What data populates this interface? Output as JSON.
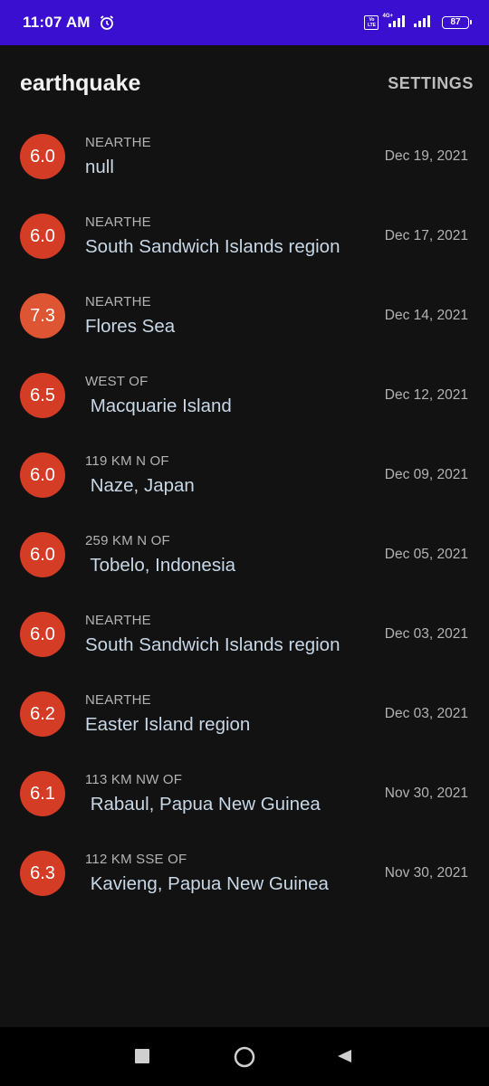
{
  "status_bar": {
    "time": "11:07 AM",
    "volte": "Vo LTE",
    "network": "4G+",
    "battery": "87"
  },
  "app_bar": {
    "title": "earthquake",
    "settings_label": "SETTINGS"
  },
  "colors": {
    "status_bar_bg": "#3a0fd0",
    "background": "#121212",
    "magnitude_circle": "#d43c25"
  },
  "quakes": [
    {
      "magnitude": "6.0",
      "offset": "NEARTHE",
      "location": "null",
      "date": "Dec 19, 2021"
    },
    {
      "magnitude": "6.0",
      "offset": "NEARTHE",
      "location": "South Sandwich Islands region",
      "date": "Dec 17, 2021"
    },
    {
      "magnitude": "7.3",
      "offset": "NEARTHE",
      "location": "Flores Sea",
      "date": "Dec 14, 2021"
    },
    {
      "magnitude": "6.5",
      "offset": "WEST OF",
      "location": " Macquarie Island",
      "date": "Dec 12, 2021"
    },
    {
      "magnitude": "6.0",
      "offset": "119 KM N OF",
      "location": " Naze, Japan",
      "date": "Dec 09, 2021"
    },
    {
      "magnitude": "6.0",
      "offset": "259 KM N OF",
      "location": " Tobelo, Indonesia",
      "date": "Dec 05, 2021"
    },
    {
      "magnitude": "6.0",
      "offset": "NEARTHE",
      "location": "South Sandwich Islands region",
      "date": "Dec 03, 2021"
    },
    {
      "magnitude": "6.2",
      "offset": "NEARTHE",
      "location": "Easter Island region",
      "date": "Dec 03, 2021"
    },
    {
      "magnitude": "6.1",
      "offset": "113 KM NW OF",
      "location": " Rabaul, Papua New Guinea",
      "date": "Nov 30, 2021"
    },
    {
      "magnitude": "6.3",
      "offset": "112 KM SSE OF",
      "location": " Kavieng, Papua New Guinea",
      "date": "Nov 30, 2021"
    }
  ],
  "nav_bar": {
    "recents_icon": "square-icon",
    "home_icon": "circle-icon",
    "back_icon": "triangle-back-icon"
  }
}
